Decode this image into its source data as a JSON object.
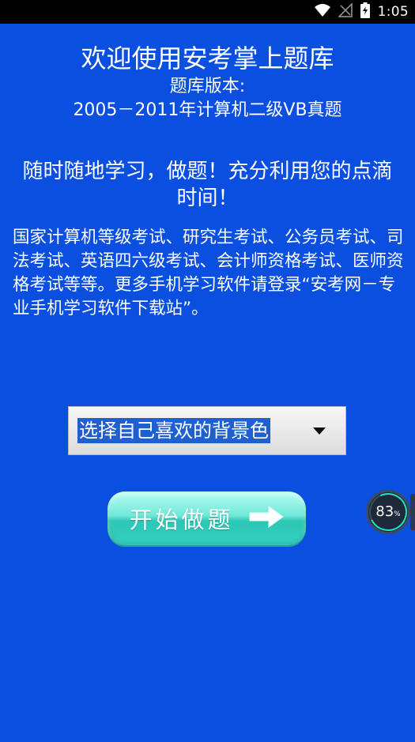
{
  "status_bar": {
    "time": "1:05",
    "icons": [
      "wifi-icon",
      "no-signal-icon",
      "battery-charging-icon"
    ]
  },
  "main": {
    "title": "欢迎使用安考掌上题库",
    "version_label": "题库版本:",
    "version_value": "2005－2011年计算机二级VB真题",
    "slogan": "随时随地学习，做题！充分利用您的点滴时间！",
    "description": "国家计算机等级考试、研究生考试、公务员考试、司法考试、英语四六级考试、会计师资格考试、医师资格考试等等。更多手机学习软件请登录“安考网－专业手机学习软件下载站”。",
    "background_select": {
      "selected": "选择自己喜欢的背景色"
    },
    "start_button": {
      "label": "开始做题",
      "icon": "arrow-right-icon"
    }
  },
  "float_widget": {
    "value": "83",
    "unit": "%"
  },
  "colors": {
    "background": "#0a4fe0",
    "button": "#33d1c1",
    "accent": "#21e0c9"
  }
}
